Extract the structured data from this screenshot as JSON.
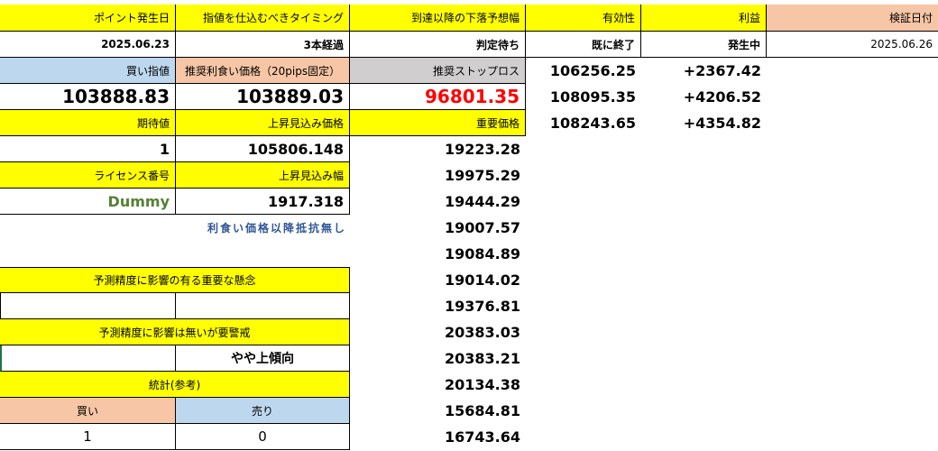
{
  "header": {
    "point_date_label": "ポイント発生日",
    "timing_label": "指値を仕込むべきタイミング",
    "drop_forecast_label": "到達以降の下落予想幅",
    "validity_label": "有効性",
    "profit_label": "利益",
    "verify_date_label": "検証日付"
  },
  "row1": {
    "point_date": "2025.06.23",
    "timing": "3本経過",
    "drop_forecast": "判定待ち",
    "validity": "既に終了",
    "profit": "発生中",
    "verify_date": "2025.06.26"
  },
  "labels": {
    "buy_limit": "買い指値",
    "take_profit": "推奨利食い価格（20pips固定）",
    "stop_loss": "推奨ストップロス",
    "expected": "期待値",
    "rise_price": "上昇見込み価格",
    "important_price": "重要価格",
    "license": "ライセンス番号",
    "rise_range": "上昇見込み幅",
    "no_resistance": "利食い価格以降抵抗無し",
    "concern": "予測精度に影響の有る重要な懸念",
    "caution": "予測精度に影響は無いが要警戒",
    "stats": "統計(参考)",
    "buy": "買い",
    "sell": "売り"
  },
  "values": {
    "buy_limit": "103888.83",
    "take_profit": "103889.03",
    "stop_loss": "96801.35",
    "expected": "1",
    "rise_price": "105806.148",
    "license": "Dummy",
    "rise_range": "1917.318",
    "concern_left": "",
    "concern_right": "",
    "caution_left": "",
    "caution_right": "やや上傾向",
    "buy_count": "1",
    "sell_count": "0"
  },
  "targets": [
    {
      "price": "106256.25",
      "profit": "+2367.42"
    },
    {
      "price": "108095.35",
      "profit": "+4206.52"
    },
    {
      "price": "108243.65",
      "profit": "+4354.82"
    }
  ],
  "important_prices": [
    "19223.28",
    "19975.29",
    "19444.29",
    "19007.57",
    "19084.89",
    "19014.02",
    "19376.81",
    "20383.03",
    "20383.21",
    "20134.38",
    "15684.81",
    "16743.64"
  ],
  "colors": {
    "yellow": "#ffff00",
    "salmon": "#f7c6a6",
    "light_blue": "#bdd7ee",
    "gray": "#d0cece",
    "red": "#ff0000",
    "green": "#548235",
    "blue": "#2f5597"
  }
}
